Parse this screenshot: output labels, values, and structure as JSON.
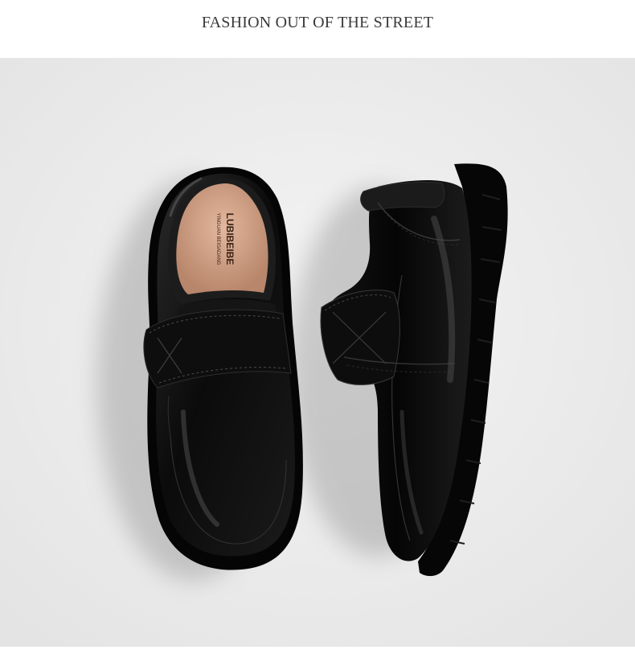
{
  "header": {
    "title": "FASHION OUT OF THE STREET"
  },
  "photo": {
    "background_color": "#ededed",
    "shoe_color": "#0c0c0c",
    "lining_color": "#d4a68c",
    "insole_brand": "LUBIBEIBE",
    "insole_sub": "YINGUAN BEIGADANG"
  }
}
